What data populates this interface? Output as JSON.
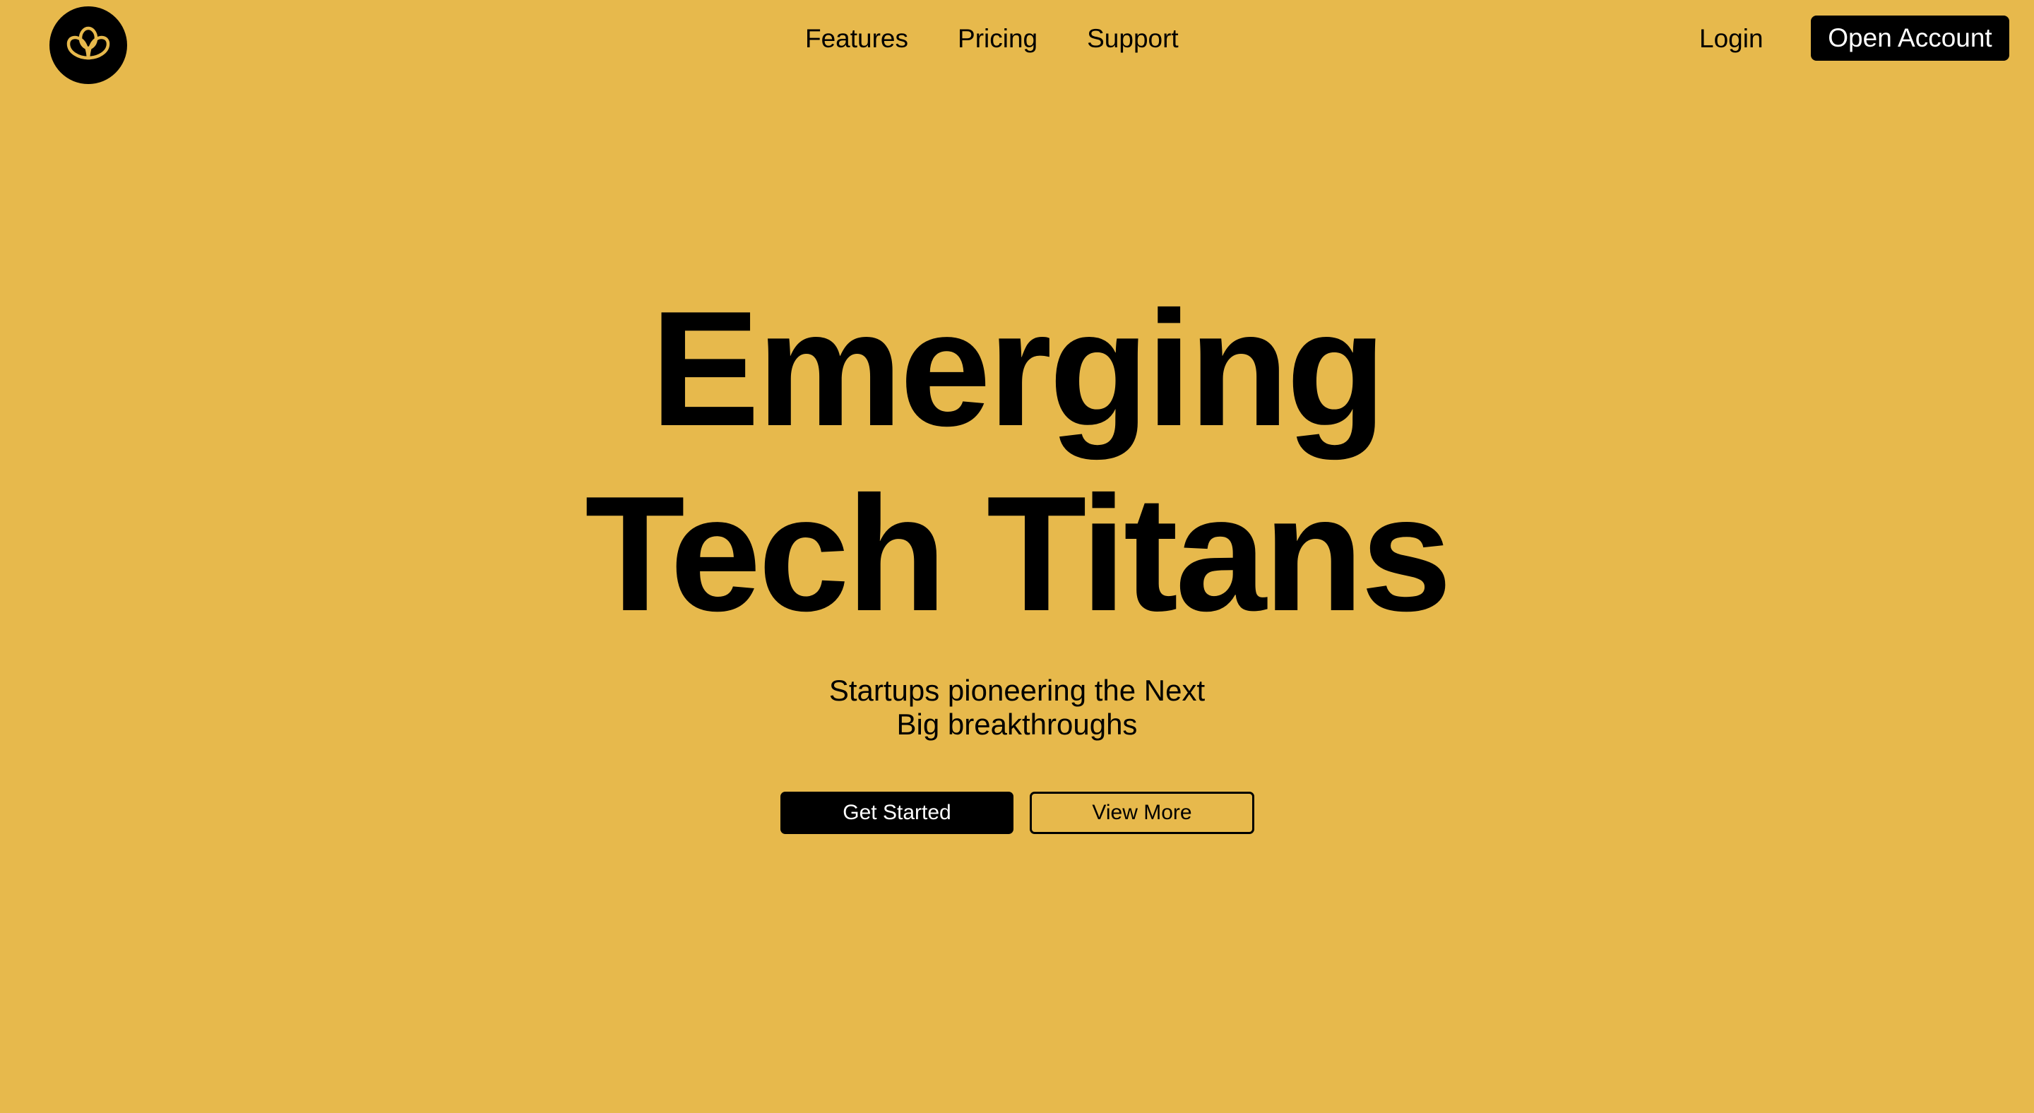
{
  "brand": {
    "logo_icon": "interlocking-loops-icon",
    "colors": {
      "background": "#e7b94c",
      "primary": "#000000",
      "on_primary": "#ffffff"
    }
  },
  "nav": {
    "links": [
      "Features",
      "Pricing",
      "Support"
    ],
    "login_label": "Login",
    "cta_label": "Open Account"
  },
  "hero": {
    "title_line1": "Emerging",
    "title_line2": "Tech Titans",
    "subtitle_line1": "Startups pioneering the Next",
    "subtitle_line2": "Big breakthroughs",
    "primary_button": "Get Started",
    "secondary_button": "View More"
  }
}
